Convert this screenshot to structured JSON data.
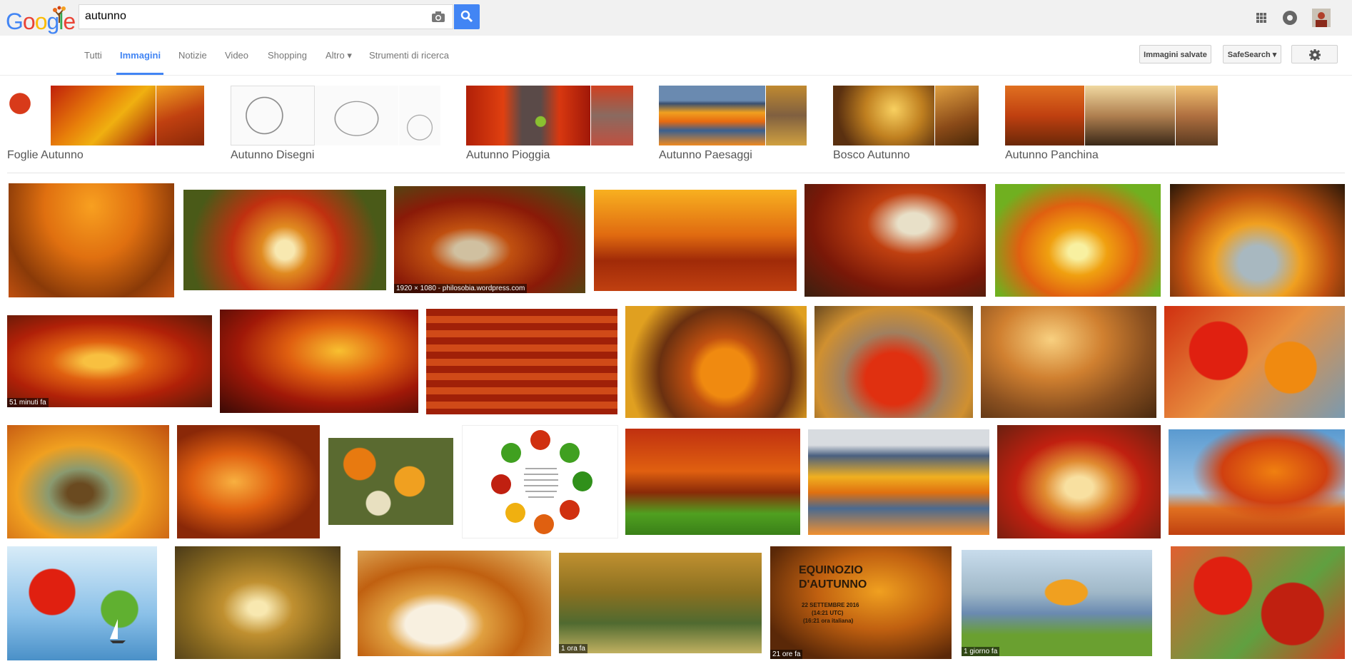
{
  "header": {
    "logo_text": "Google",
    "search_query": "autunno"
  },
  "tabs": [
    {
      "label": "Tutti"
    },
    {
      "label": "Immagini"
    },
    {
      "label": "Notizie"
    },
    {
      "label": "Video"
    },
    {
      "label": "Shopping"
    },
    {
      "label": "Altro ▾"
    },
    {
      "label": "Strumenti di ricerca"
    }
  ],
  "toolbar": {
    "saved_label": "Immagini salvate",
    "safesearch_label": "SafeSearch ▾"
  },
  "related": [
    {
      "label": "Foglie Autunno"
    },
    {
      "label": "Autunno Disegni"
    },
    {
      "label": "Autunno Pioggia"
    },
    {
      "label": "Autunno Paesaggi"
    },
    {
      "label": "Bosco Autunno"
    },
    {
      "label": "Autunno Panchina"
    }
  ],
  "results": {
    "caption_1": "1920 × 1080 - philosobia.wordpress.com",
    "caption_2": "51 minuti fa",
    "caption_3": "1 ora fa",
    "caption_4": "21 ore fa",
    "caption_5": "1 giorno fa",
    "equinox_title_1": "EQUINOZIO",
    "equinox_title_2": "D'AUTUNNO",
    "equinox_date": "22 SETTEMBRE 2016",
    "equinox_utc": "(14:21 UTC)",
    "equinox_it": "(16:21 ora italiana)"
  },
  "colors": {
    "accent": "#4285f4",
    "topbar_bg": "#f1f1f1"
  }
}
